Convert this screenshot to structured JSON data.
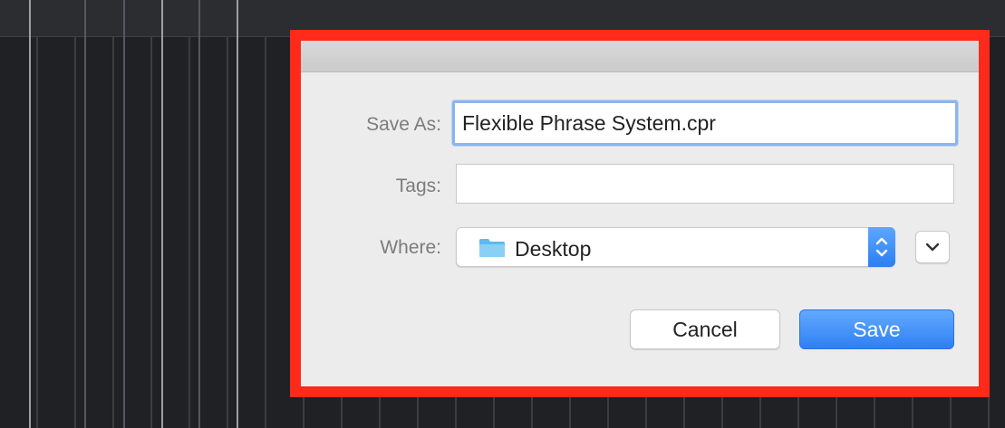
{
  "dialog": {
    "save_as_label": "Save As:",
    "save_as_value": "Flexible Phrase System.cpr",
    "tags_label": "Tags:",
    "tags_value": "",
    "where_label": "Where:",
    "where_value": "Desktop",
    "where_icon": "folder-icon",
    "cancel_label": "Cancel",
    "save_label": "Save"
  },
  "colors": {
    "highlight": "#ff2a1a",
    "accent": "#2f7ff3",
    "dialog_bg": "#ececec"
  }
}
